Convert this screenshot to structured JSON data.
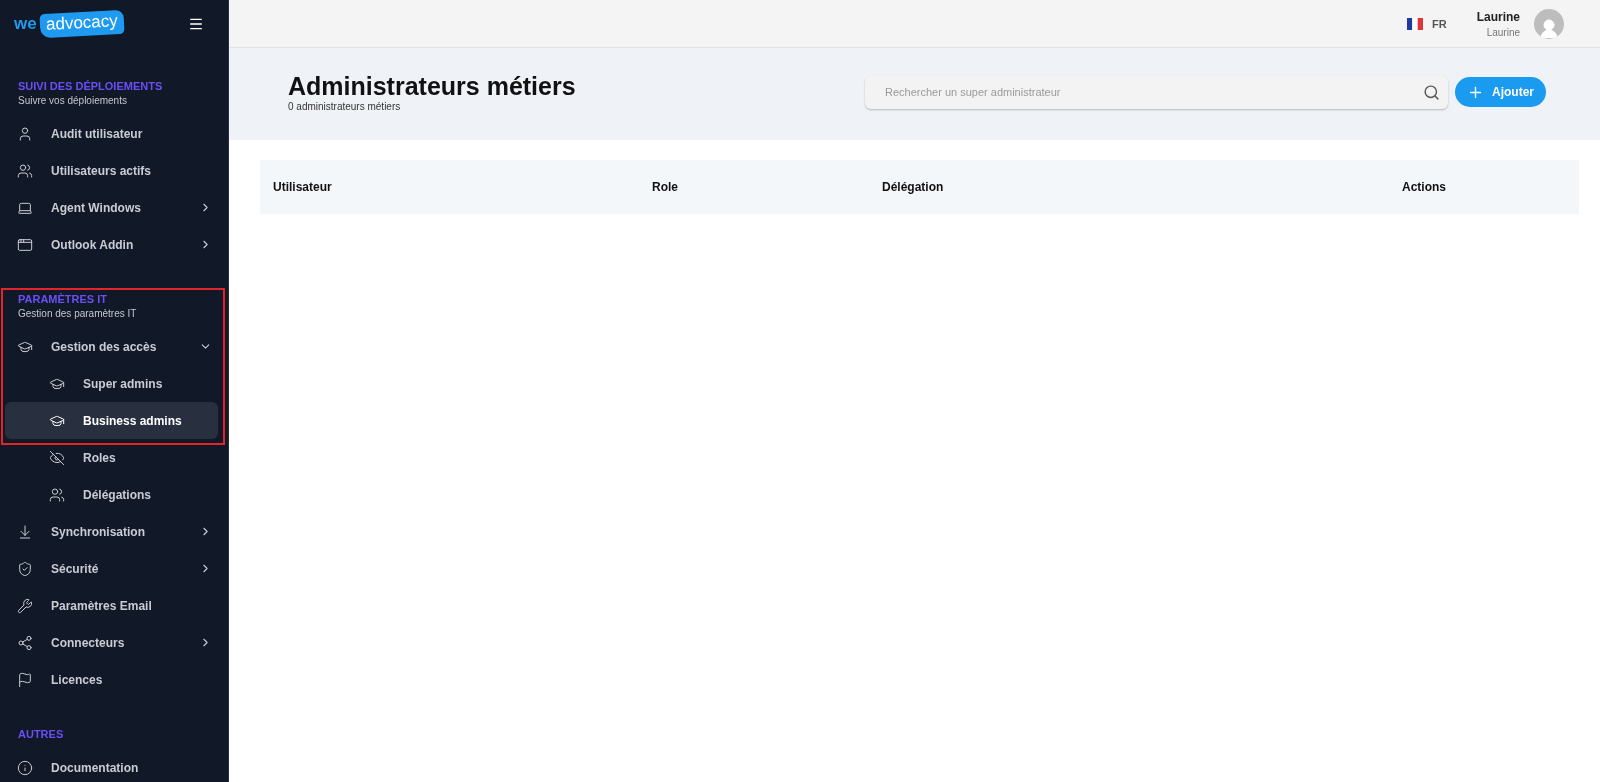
{
  "logo": {
    "prefix": "we",
    "name": "advocacy"
  },
  "sidebar": {
    "sections": [
      {
        "title": "SUIVI DES DÉPLOIEMENTS",
        "subtitle": "Suivre vos déploiements",
        "items": [
          {
            "label": "Audit utilisateur",
            "kind": "link",
            "selected": false
          },
          {
            "label": "Utilisateurs actifs",
            "kind": "link",
            "selected": false
          },
          {
            "label": "Agent Windows",
            "kind": "group",
            "expanded": false,
            "selected": false
          },
          {
            "label": "Outlook Addin",
            "kind": "group",
            "expanded": false,
            "selected": false
          }
        ]
      },
      {
        "title": "PARAMÈTRES IT",
        "subtitle": "Gestion des paramètres IT",
        "items": [
          {
            "label": "Gestion des accès",
            "kind": "group",
            "expanded": true,
            "selected": false,
            "children": [
              {
                "label": "Super admins",
                "selected": false
              },
              {
                "label": "Business admins",
                "selected": true
              },
              {
                "label": "Roles",
                "selected": false
              },
              {
                "label": "Délégations",
                "selected": false
              }
            ]
          },
          {
            "label": "Synchronisation",
            "kind": "group",
            "expanded": false,
            "selected": false
          },
          {
            "label": "Sécurité",
            "kind": "group",
            "expanded": false,
            "selected": false
          },
          {
            "label": "Paramètres Email",
            "kind": "link",
            "selected": false
          },
          {
            "label": "Connecteurs",
            "kind": "group",
            "expanded": false,
            "selected": false
          },
          {
            "label": "Licences",
            "kind": "link",
            "selected": false
          }
        ]
      },
      {
        "title": "AUTRES",
        "items": [
          {
            "label": "Documentation",
            "kind": "link",
            "selected": false
          }
        ]
      }
    ]
  },
  "annotation": {
    "kind": "highlight-frame"
  },
  "topbar": {
    "language": "FR",
    "user": {
      "name": "Laurine",
      "login": "Laurine"
    }
  },
  "header": {
    "title": "Administrateurs métiers",
    "count": "0 administrateurs métiers",
    "search": {
      "placeholder": "Rechercher un super administrateur"
    },
    "add_button": "Ajouter"
  },
  "table": {
    "columns": [
      "Utilisateur",
      "Role",
      "Délégation",
      "Actions"
    ]
  }
}
